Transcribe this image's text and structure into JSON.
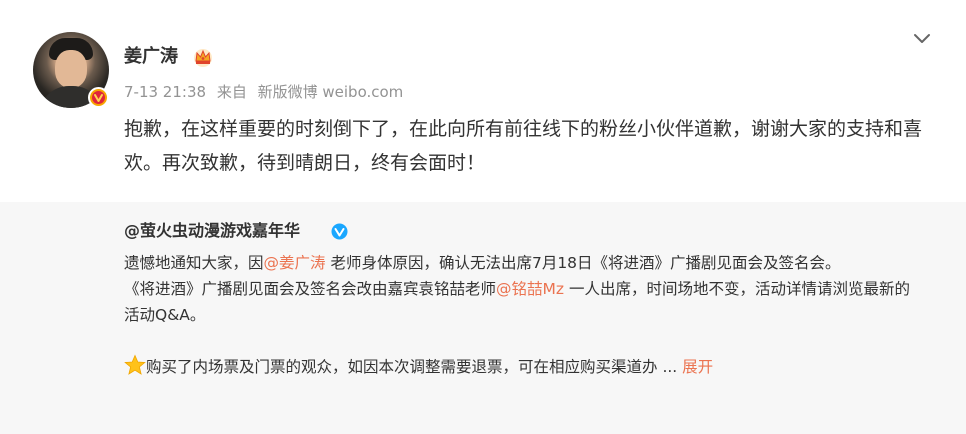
{
  "post": {
    "author": "姜广涛",
    "time": "7-13 21:38",
    "source_prefix": "来自",
    "source": "新版微博 weibo.com",
    "text": "抱歉，在这样重要的时刻倒下了，在此向所有前往线下的粉丝小伙伴道歉，谢谢大家的支持和喜欢。再次致歉，待到晴朗日，终有会面时！"
  },
  "repost": {
    "author": "@萤火虫动漫游戏嘉年华",
    "line1_a": "遗憾地通知大家，因",
    "line1_mention": "@姜广涛",
    "line1_b": " 老师身体原因，确认无法出席7月18日《将进酒》广播剧见面会及签名会。",
    "line2_a": "《将进酒》广播剧见面会及签名会改由嘉宾袁铭喆老师",
    "line2_mention": "@铭喆Mz",
    "line2_b": " 一人出席，时间场地不变，活动详情请浏览最新的活动Q&A。",
    "line3": "购买了内场票及门票的观众，如因本次调整需要退票，可在相应购买渠道办 ",
    "ellipsis": "...",
    "expand_label": "展开"
  },
  "icons": {
    "menu": "chevron-down-icon",
    "verified": "verified-badge-icon",
    "crown": "crown-icon",
    "star": "star-icon"
  },
  "colors": {
    "mention": "#eb7350",
    "meta": "#939393",
    "repost_bg": "#f7f7f7",
    "verified_blue": "#1aa7ff"
  }
}
